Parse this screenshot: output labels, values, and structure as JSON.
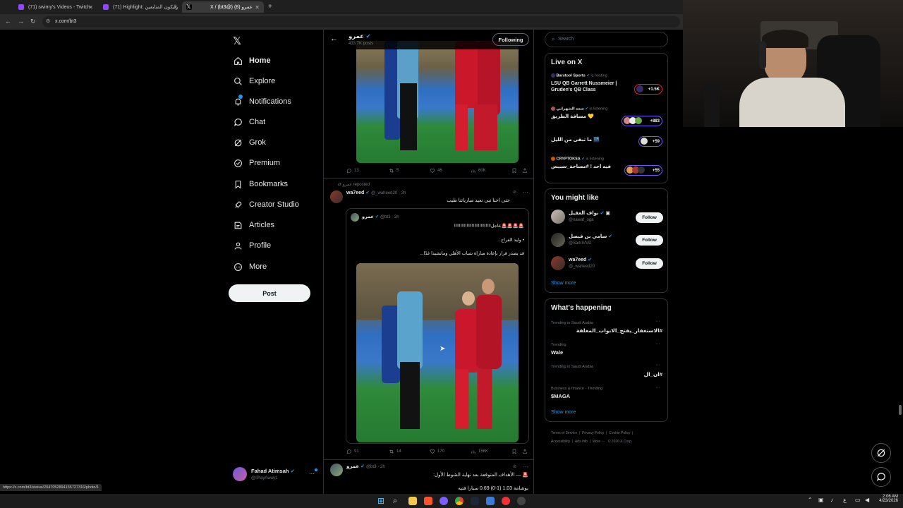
{
  "browser": {
    "tabs": [
      {
        "label": "(71) swimy's Videos - Twitch",
        "color": "#9146ff"
      },
      {
        "label": "(71) Highlight: رايكون المتابعين",
        "color": "#9146ff"
      },
      {
        "label": "X / (bt3@) عمرو (8)",
        "color": "#000000"
      }
    ],
    "new_tab": "+",
    "url": "x.com/bt3",
    "status_url": "https://x.com/bt3/status/2047052894155727316/photo/1"
  },
  "nav": {
    "items": [
      {
        "label": "Home",
        "icon": "home-icon"
      },
      {
        "label": "Explore",
        "icon": "search-icon"
      },
      {
        "label": "Notifications",
        "icon": "bell-icon"
      },
      {
        "label": "Chat",
        "icon": "chat-icon"
      },
      {
        "label": "Grok",
        "icon": "grok-icon"
      },
      {
        "label": "Premium",
        "icon": "premium-icon"
      },
      {
        "label": "Bookmarks",
        "icon": "bookmark-icon"
      },
      {
        "label": "Creator Studio",
        "icon": "rocket-icon"
      },
      {
        "label": "Articles",
        "icon": "articles-icon"
      },
      {
        "label": "Profile",
        "icon": "profile-icon"
      },
      {
        "label": "More",
        "icon": "more-icon"
      }
    ],
    "post_label": "Post",
    "account": {
      "name": "Fahad Atimsah",
      "handle": "@IPlayAway1",
      "more": "···"
    }
  },
  "header": {
    "name": "عمرو",
    "posts": "433.7K posts",
    "follow_label": "Following"
  },
  "posts": {
    "first_actions": {
      "replies": "13",
      "reposts": "5",
      "likes": "46",
      "views": "60K"
    },
    "reposted_label": "عمرو reposted",
    "second": {
      "author": "wa7eed",
      "handle": "@_waheed20",
      "time": "· 2h",
      "text": "حتى احنا نبي نعيد مبارياتنا طيب",
      "quote": {
        "author": "عمرو",
        "handle": "@bt3",
        "time": "· 2h",
        "line1": "🚨🚨🚨🚨عاجل!!!!!!!!!!!!!!!!!!!!!!!!!!!!!",
        "line2": "• وليد الفراج :",
        "line3": "قد يصدر قرار بإعادة مباراة شباب الأهلي وماتشيدا غدًا..."
      },
      "actions": {
        "replies": "91",
        "reposts": "14",
        "likes": "170",
        "views": "156K"
      }
    },
    "third": {
      "author": "عمرو",
      "handle": "@bt3",
      "time": "· 2h",
      "line1": "🚨 — الأهداف المتوقعة بعد نهاية الشوط الأول:",
      "line2": "بوشامة 1.03 (1-0) 0.69 سيارا فتيه"
    }
  },
  "search": {
    "placeholder": "Search"
  },
  "live": {
    "title": "Live on X",
    "items": [
      {
        "host": "Barstool Sports",
        "status": "is hosting",
        "title": "LSU QB Garrett Nussmeier | Gruden's QB Class",
        "count": "+1.5K"
      },
      {
        "host": "سعد الشهراني",
        "status": "is listening",
        "title": "مسافة الطريق 💛",
        "count": "+883"
      },
      {
        "host": "",
        "status": "",
        "title": "ما تبقى من الليل 🌃",
        "count": "+59"
      },
      {
        "host": "CRYPTOKSA",
        "status": "is listening",
        "title": "فيه احد ! #مساحة_سبيس",
        "count": "+55"
      }
    ]
  },
  "might_like": {
    "title": "You might like",
    "users": [
      {
        "name": "نواف العقيل",
        "handle": "@nawaf_oga",
        "button": "Follow"
      },
      {
        "name": "سامي بن فيصل",
        "handle": "@SamIVVD",
        "button": "Follow"
      },
      {
        "name": "wa7eed",
        "handle": "@_waheed20",
        "button": "Follow"
      }
    ],
    "show_more": "Show more"
  },
  "happening": {
    "title": "What's happening",
    "trends": [
      {
        "meta": "Trending in Saudi Arabia",
        "name": "#الاستغفار_يفتح_الابواب_المغلقة"
      },
      {
        "meta": "Trending",
        "name": "Wale"
      },
      {
        "meta": "Trending in Saudi Arabia",
        "name": "#ان_ال"
      },
      {
        "meta": "Business & finance · Trending",
        "name": "$MAGA"
      }
    ],
    "show_more": "Show more"
  },
  "footer": {
    "links": [
      "Terms of Service",
      "Privacy Policy",
      "Cookie Policy",
      "Accessibility",
      "Ads info",
      "More ···",
      "© 2026 X Corp."
    ]
  },
  "taskbar": {
    "time": "2:06 AM",
    "date": "4/23/2026",
    "lang": "ع"
  }
}
